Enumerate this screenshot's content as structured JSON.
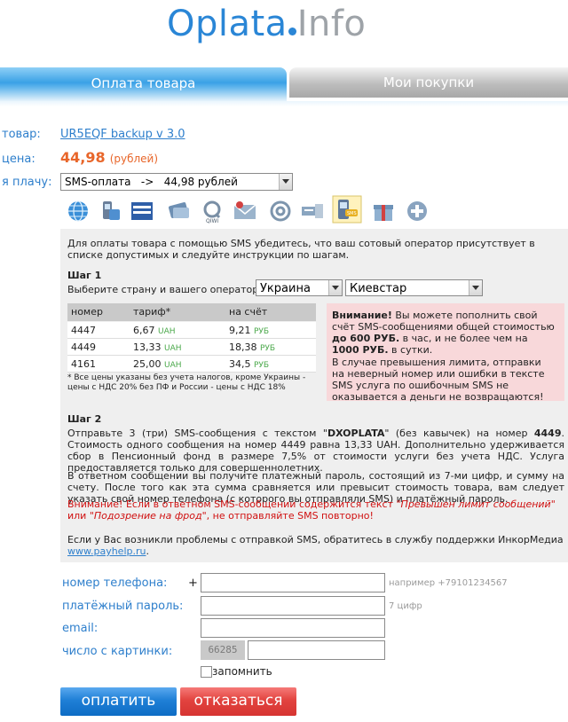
{
  "logo": {
    "part1": "Oplata",
    "part2": "Info"
  },
  "tabs": [
    {
      "label": "Оплата товара"
    },
    {
      "label": "Мои покупки"
    }
  ],
  "product": {
    "item_label": "товар:",
    "item_name": "UR5EQF backup v 3.0",
    "price_label": "цена:",
    "price_value": "44,98",
    "price_unit": "(рублей)",
    "pay_label": "я плачу:",
    "pay_method": "SMS-оплата   ->   44,98 рублей"
  },
  "payment_icons": [
    "globe-icon",
    "phone-card-icon",
    "russian-post-icon",
    "money-transfer-icon",
    "qiwi-icon",
    "mail-envelope-icon",
    "at-sign-icon",
    "atm-card-icon",
    "sms-phone-icon",
    "gift-icon",
    "plus-icon"
  ],
  "info": {
    "intro": "Для оплаты товара с помощью SMS убедитесь, что ваш сотовый оператор присутствует в списке допустимых и следуйте инструкции по шагам.",
    "step1_title": "Шаг 1",
    "step1_text": "Выберите страну и вашего оператора:",
    "country": "Украина",
    "operator": "Киевстар",
    "table": {
      "headers": [
        "номер",
        "тариф*",
        "на счёт"
      ],
      "rows": [
        {
          "number": "4447",
          "tariff": "6,67",
          "tariff_cur": "UAH",
          "credit": "9,21",
          "credit_cur": "РУБ"
        },
        {
          "number": "4449",
          "tariff": "13,33",
          "tariff_cur": "UAH",
          "credit": "18,38",
          "credit_cur": "РУБ"
        },
        {
          "number": "4161",
          "tariff": "25,00",
          "tariff_cur": "UAH",
          "credit": "34,5",
          "credit_cur": "РУБ"
        }
      ],
      "footnote": "* Все цены указаны без учета налогов, кроме Украины - цены с НДС 20% без ПФ и России - цены с НДС 18%"
    },
    "warning": {
      "title": "Внимание!",
      "text1": " Вы можете пополнить свой счёт SMS-сообщениями общей стоимостью ",
      "amount1": "до 600 РУБ.",
      "text2": " в час, и не более чем на ",
      "amount2": "1000 РУБ.",
      "text3": " в сутки.",
      "text4": "В случае превышения лимита, отправки на неверный номер или ошибки в тексте SMS услуга по ошибочным SMS не оказывается а деньги не возвращаются!"
    },
    "step2_title": "Шаг 2",
    "step2_a": "Отправьте 3 (три) SMS-сообщения с текстом \"",
    "step2_code": "DXOPLATA",
    "step2_b": "\" (без кавычек) на номер ",
    "step2_num": "4449",
    "step2_c": ". Стоимость одного сообщения на номер 4449 равна 13,33 UAH. Дополнительно удерживается сбор в Пенсионный фонд в размере 7,5% от стоимости услуги без учета НДС. Услуга предоставляется только для совершеннолетних.",
    "step2_d": "В ответном сообщении вы получите платежный пароль, состоящий из 7-ми цифр, и сумму на счету. После того как эта сумма сравняется или превысит стоимость товара, вам следует указать свой номер телефона (с которого вы отправляли SMS) и платёжный пароль.",
    "alert_a": "Внимание! Если в ответном SMS-сообщении содержится текст ",
    "alert_q1": "\"Превышен лимит сообщений\"",
    "alert_b": " или ",
    "alert_q2": "\"Подозрение на фрод\"",
    "alert_c": ", не отправляйте SMS повторно!",
    "support_text": "Если у Вас возникли проблемы с отправкой SMS, обратитесь в службу поддержки ИнкорМедиа",
    "support_link": "www.payhelp.ru",
    "support_end": "."
  },
  "form": {
    "phone_label": "номер телефона:",
    "phone_prefix": "+",
    "phone_value": "",
    "phone_hint": "например +79101234567",
    "password_label": "платёжный пароль:",
    "password_value": "",
    "password_hint": "7 цифр",
    "email_label": "email:",
    "email_value": "",
    "captcha_label": "число с картинки:",
    "captcha_code": "66285",
    "captcha_value": "",
    "remember_label": "запомнить",
    "pay_button": "оплатить",
    "cancel_button": "отказаться"
  }
}
